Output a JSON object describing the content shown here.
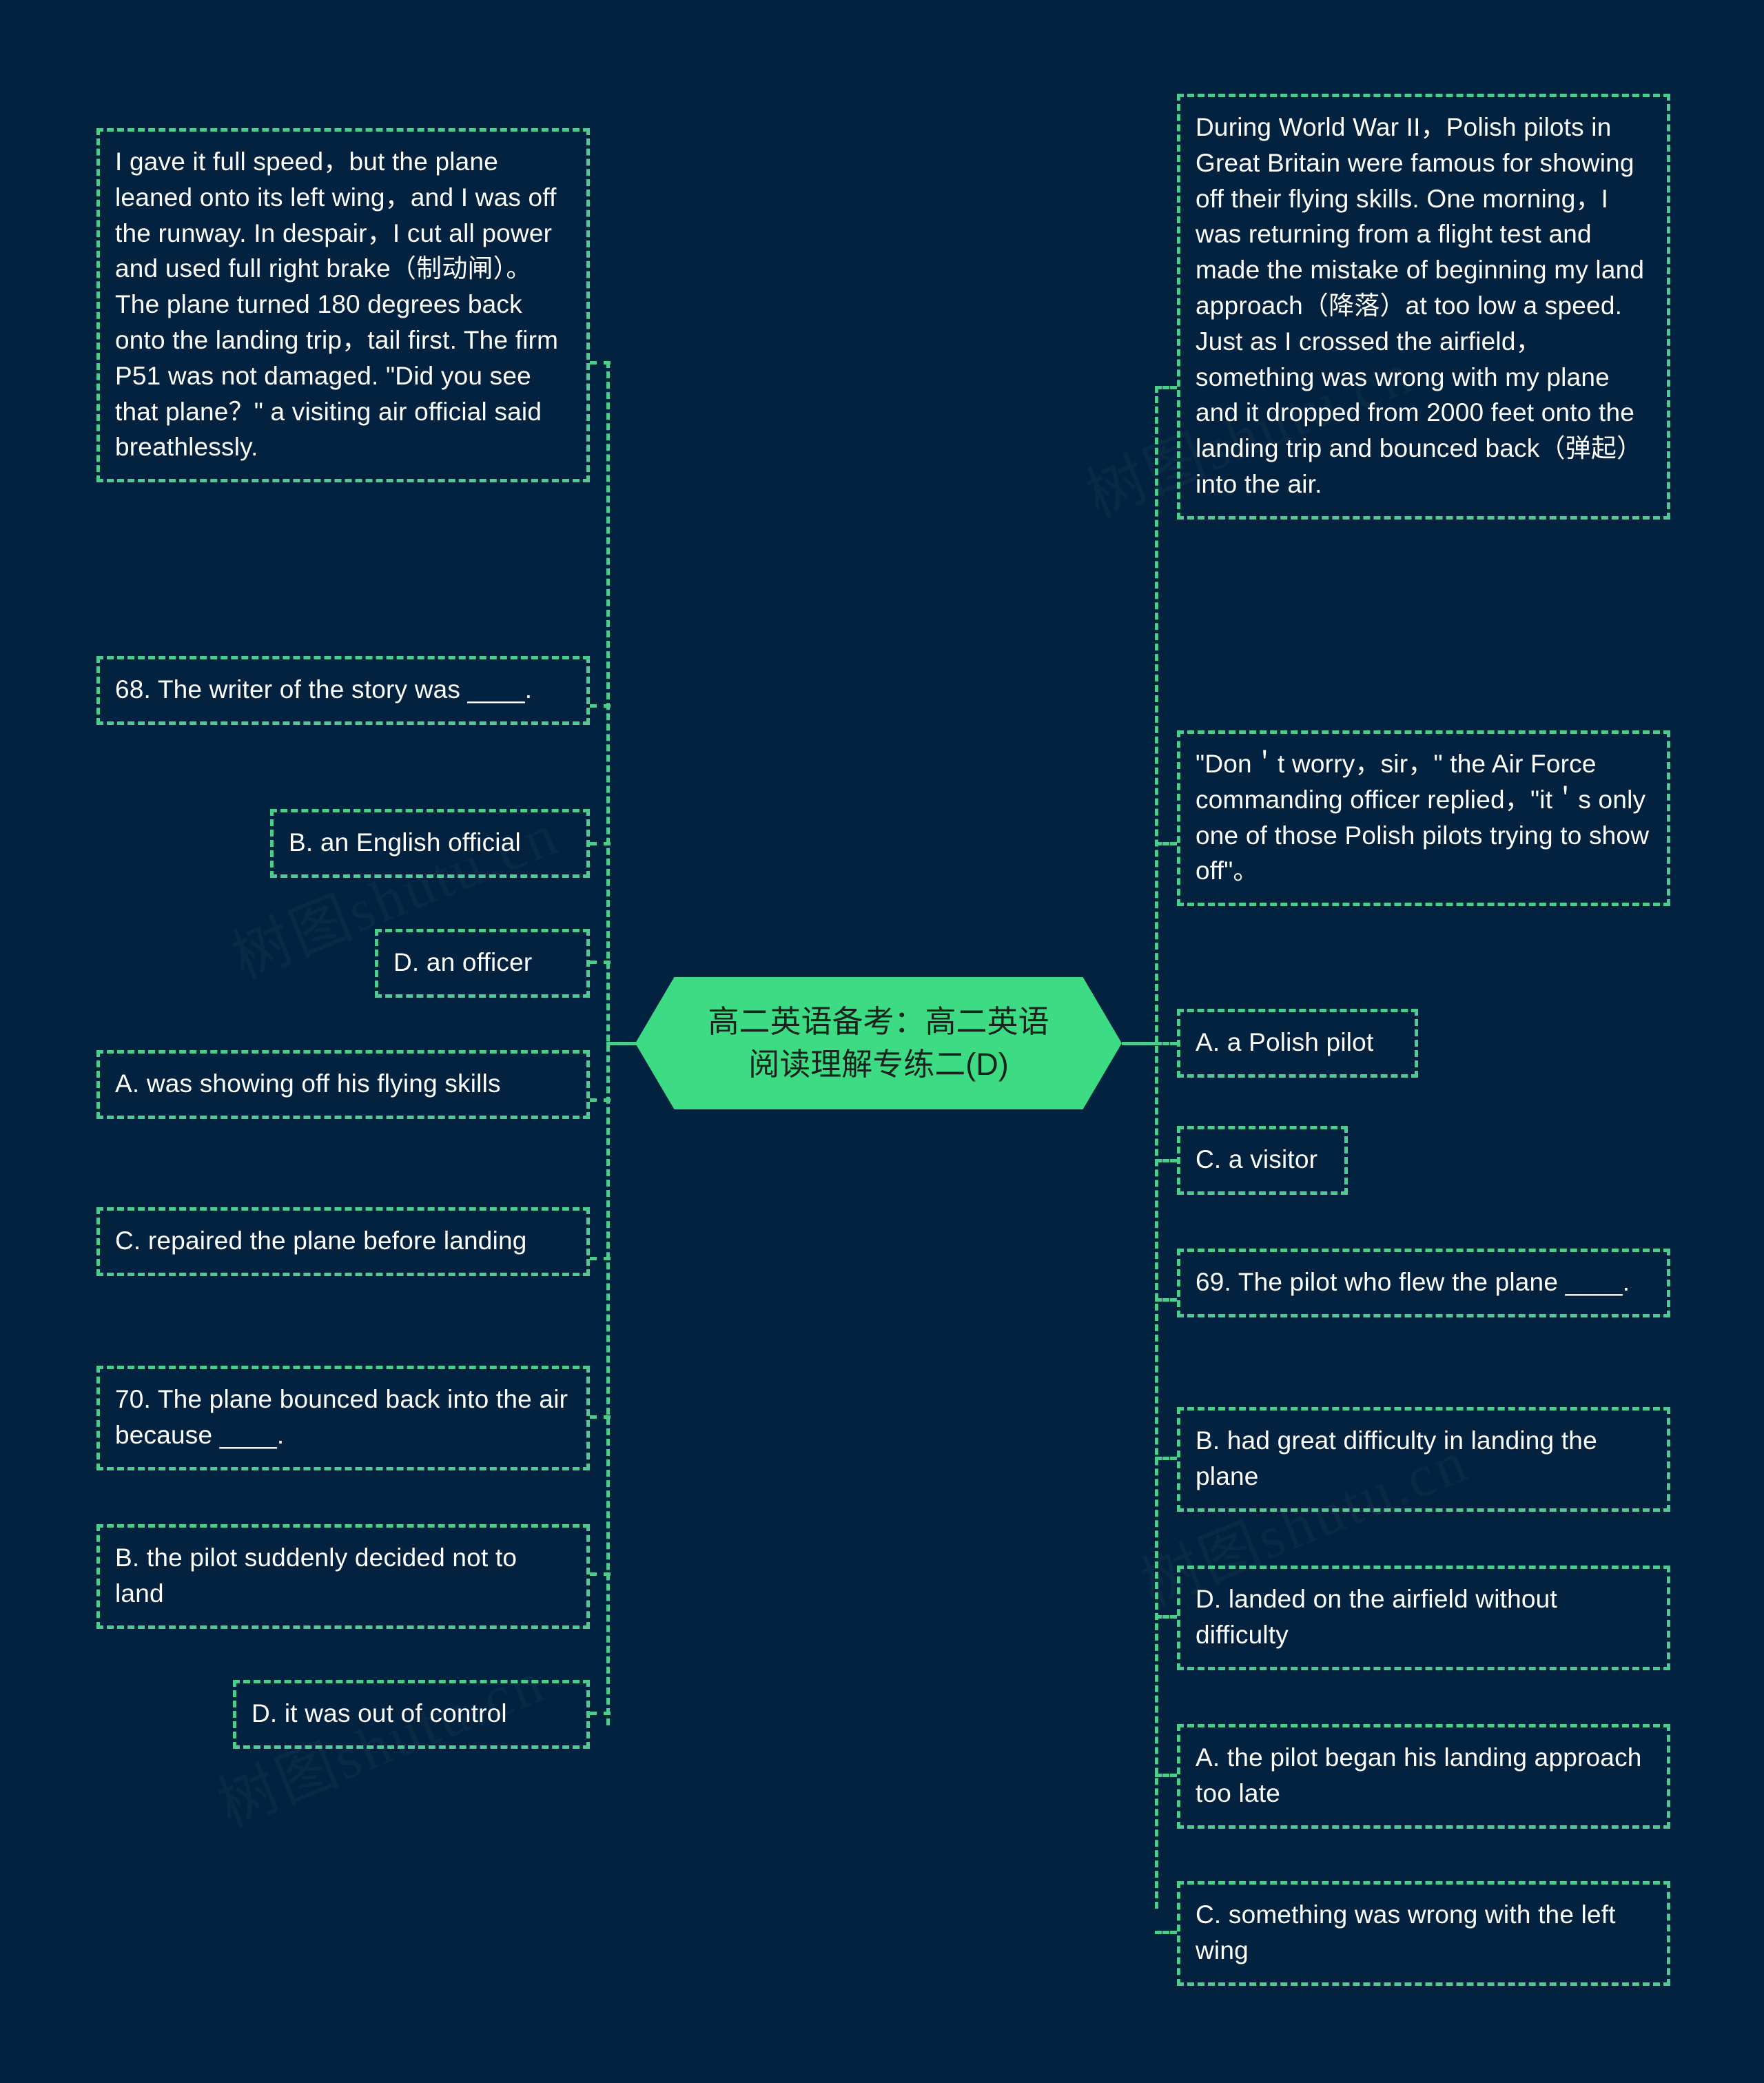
{
  "meta": {
    "background_color": "#02223f",
    "accent_color": "#4ecb8f",
    "center_fill": "#3ddc84",
    "center_text_color": "#16241d",
    "node_text_color": "#ffffff"
  },
  "watermarks": [
    "树图shutu.cn",
    "树图shutu.cn",
    "树图shutu.cn",
    "树图shutu.cn"
  ],
  "center": {
    "line1": "高二英语备考：高二英语",
    "line2": "阅读理解专练二(D)"
  },
  "left_branch": [
    {
      "id": "passage-part2",
      "text": "I gave it full speed，but the plane leaned onto its left wing，and I was off the runway. In despair，I cut all power and used full right brake（制动闸）。The plane turned 180 degrees back onto the landing trip，tail first. The firm P51 was not damaged. \"Did you see that plane？\" a visiting air official said breathlessly."
    },
    {
      "id": "question-68",
      "text": "68. The writer of the story was ____."
    },
    {
      "id": "q68-option-b",
      "text": "B. an English official"
    },
    {
      "id": "q68-option-d",
      "text": "D. an officer"
    },
    {
      "id": "q69-option-a",
      "text": "A. was showing off his flying skills"
    },
    {
      "id": "q69-option-c",
      "text": "C. repaired the plane before landing"
    },
    {
      "id": "question-70",
      "text": "70. The plane bounced back into the air because ____."
    },
    {
      "id": "q70-option-b",
      "text": "B. the pilot suddenly decided not to land"
    },
    {
      "id": "q70-option-d",
      "text": "D. it was out of control"
    }
  ],
  "right_branch": [
    {
      "id": "passage-part1",
      "text": "During World War II，Polish pilots in Great Britain were famous for showing off their flying skills. One morning，I was returning from a flight test and made the mistake of beginning my land approach（降落）at too low a speed. Just as I crossed the airfield，something was wrong with my plane and it dropped from 2000 feet onto the landing trip and bounced back（弹起）into the air."
    },
    {
      "id": "passage-part3",
      "text": "\"Don＇t worry，sir，\" the Air Force commanding officer replied，\"it＇s only one of those Polish pilots trying to show off\"。"
    },
    {
      "id": "q68-option-a",
      "text": "A. a Polish pilot"
    },
    {
      "id": "q68-option-c",
      "text": "C. a visitor"
    },
    {
      "id": "question-69",
      "text": "69. The pilot who flew the plane ____."
    },
    {
      "id": "q69-option-b",
      "text": "B. had great difficulty in landing the plane"
    },
    {
      "id": "q69-option-d",
      "text": "D. landed on the airfield without difficulty"
    },
    {
      "id": "q70-option-a",
      "text": "A. the pilot began his landing approach too late"
    },
    {
      "id": "q70-option-c",
      "text": "C. something was wrong with the left wing"
    }
  ]
}
